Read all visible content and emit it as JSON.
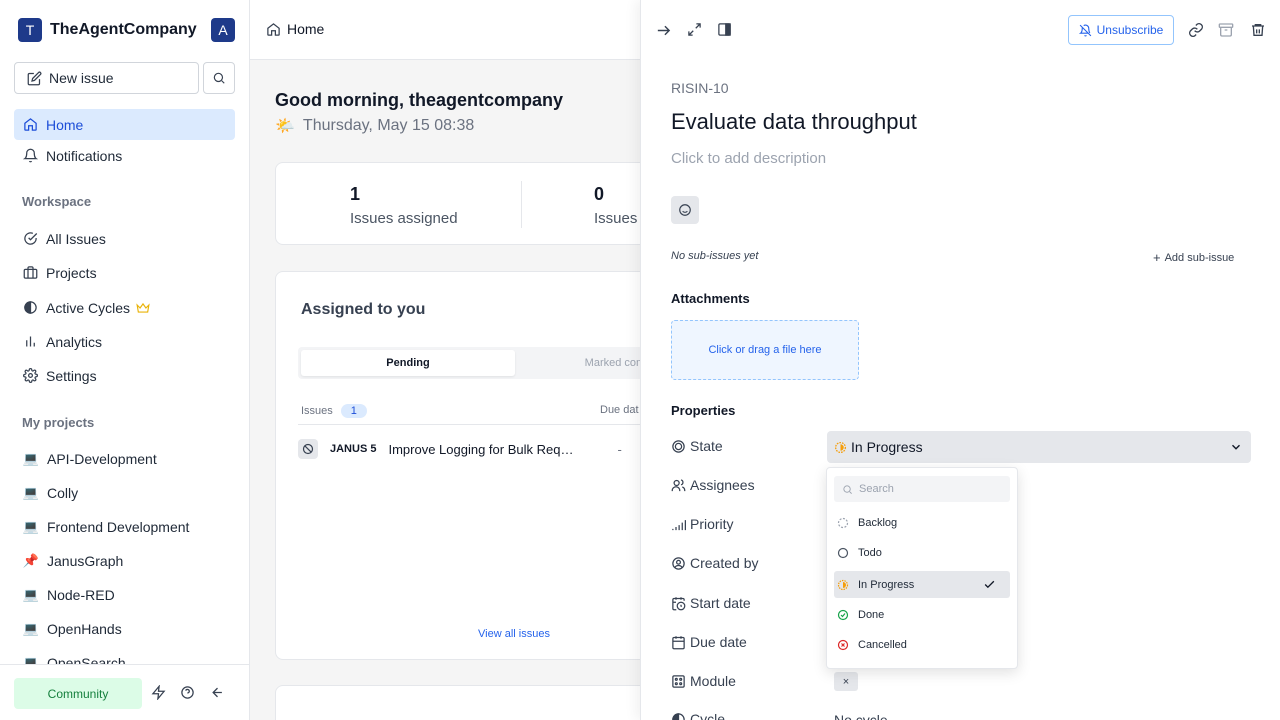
{
  "workspace": {
    "logo_letter": "T",
    "name": "TheAgentCompany",
    "avatar_letter": "A"
  },
  "sidebar": {
    "new_issue_label": "New issue",
    "nav": [
      {
        "label": "Home"
      },
      {
        "label": "Notifications"
      }
    ],
    "workspace_title": "Workspace",
    "workspace_items": [
      {
        "label": "All Issues"
      },
      {
        "label": "Projects"
      },
      {
        "label": "Active Cycles"
      },
      {
        "label": "Analytics"
      },
      {
        "label": "Settings"
      }
    ],
    "projects_title": "My projects",
    "projects": [
      {
        "label": "API-Development",
        "icon": "💻"
      },
      {
        "label": "Colly",
        "icon": "💻"
      },
      {
        "label": "Frontend Development",
        "icon": "💻"
      },
      {
        "label": "JanusGraph",
        "icon": "📌"
      },
      {
        "label": "Node-RED",
        "icon": "💻"
      },
      {
        "label": "OpenHands",
        "icon": "💻"
      },
      {
        "label": "OpenSearch",
        "icon": "💻"
      }
    ],
    "community_label": "Community"
  },
  "topbar": {
    "breadcrumb": "Home"
  },
  "home": {
    "greeting": "Good morning, theagentcompany",
    "date": "Thursday, May 15 08:38",
    "stats": [
      {
        "value": "1",
        "label": "Issues assigned"
      },
      {
        "value": "0",
        "label": "Issues"
      }
    ],
    "assigned": {
      "title": "Assigned to you",
      "tab_pending": "Pending",
      "tab_completed": "Marked comp",
      "col_issues": "Issues",
      "issue_count": "1",
      "col_due": "Due dat",
      "rows": [
        {
          "id": "JANUS 5",
          "name": "Improve Logging for Bulk Request Failures",
          "due": "-"
        }
      ],
      "view_all": "View all issues"
    }
  },
  "peek": {
    "unsubscribe_label": "Unsubscribe",
    "issue_id": "RISIN-10",
    "title": "Evaluate data throughput",
    "description_placeholder": "Click to add description",
    "no_sub_issues": "No sub-issues yet",
    "add_sub_issue": "Add sub-issue",
    "attachments_title": "Attachments",
    "dropzone_text": "Click or drag a file here",
    "properties_title": "Properties",
    "props": {
      "state": "State",
      "assignees": "Assignees",
      "priority": "Priority",
      "created_by": "Created by",
      "start_date": "Start date",
      "due_date": "Due date",
      "module": "Module",
      "cycle": "Cycle"
    },
    "state_value": "In Progress",
    "module_chip": "×",
    "cycle_value": "No cycle"
  },
  "state_dropdown": {
    "search_placeholder": "Search",
    "options": [
      {
        "label": "Backlog",
        "color": "#9ca3af"
      },
      {
        "label": "Todo",
        "color": "#4b5563"
      },
      {
        "label": "In Progress",
        "color": "#f59e0b",
        "selected": true
      },
      {
        "label": "Done",
        "color": "#16a34a"
      },
      {
        "label": "Cancelled",
        "color": "#dc2626"
      }
    ]
  }
}
